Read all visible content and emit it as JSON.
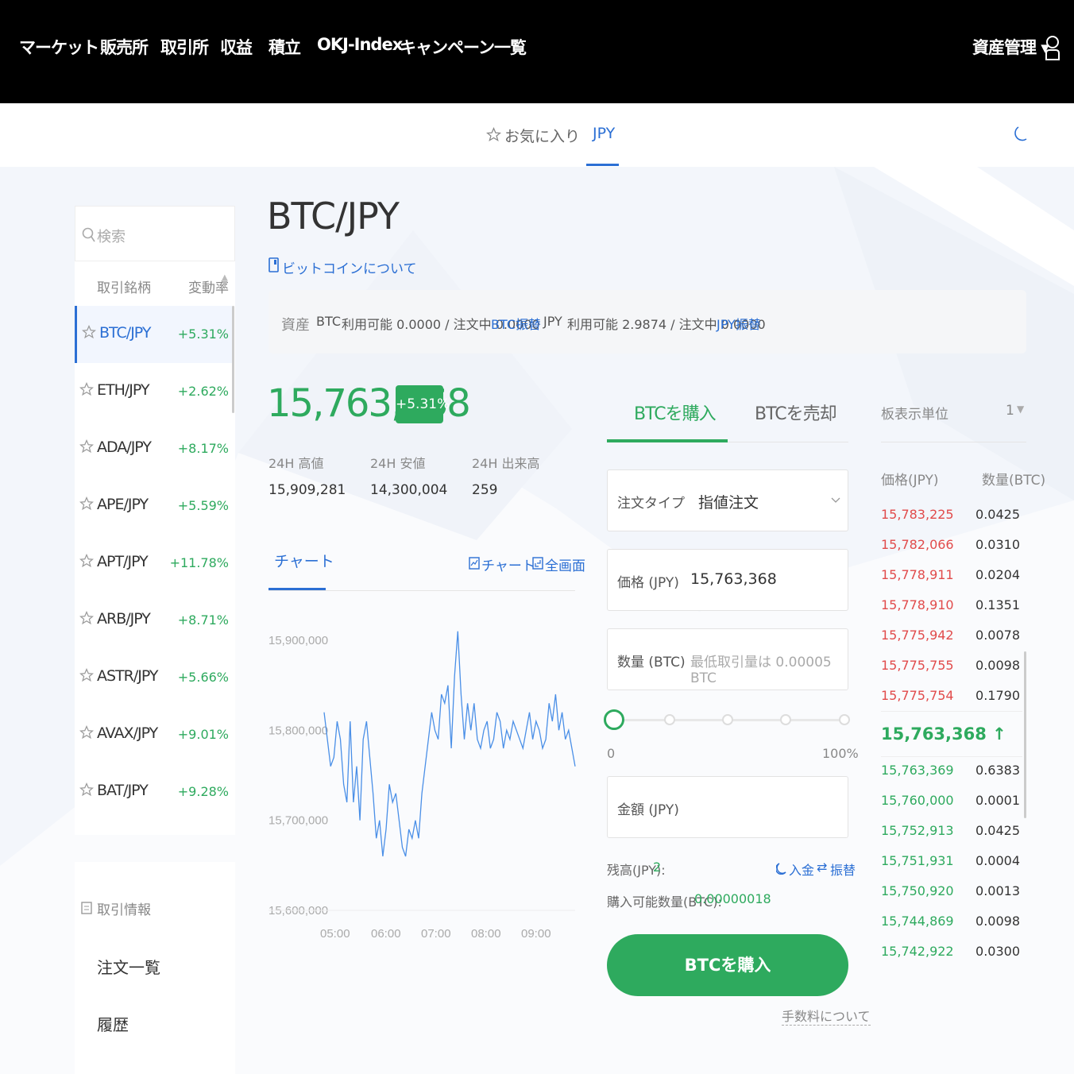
{
  "nav": {
    "items": [
      "マーケット",
      "販売所",
      "取引所",
      "収益",
      "積立",
      "OKJ-Index",
      "キャンペーン一覧"
    ],
    "asset_mgmt": "資産管理 ▾"
  },
  "subnav": {
    "favorites": "お気に入り",
    "jpy": "JPY"
  },
  "sidebar": {
    "search_placeholder": "検索",
    "col_pair": "取引銘柄",
    "col_change": "変動率",
    "pairs": [
      {
        "symbol": "BTC/JPY",
        "change": "+5.31%"
      },
      {
        "symbol": "ETH/JPY",
        "change": "+2.62%"
      },
      {
        "symbol": "ADA/JPY",
        "change": "+8.17%"
      },
      {
        "symbol": "APE/JPY",
        "change": "+5.59%"
      },
      {
        "symbol": "APT/JPY",
        "change": "+11.78%"
      },
      {
        "symbol": "ARB/JPY",
        "change": "+8.71%"
      },
      {
        "symbol": "ASTR/JPY",
        "change": "+5.66%"
      },
      {
        "symbol": "AVAX/JPY",
        "change": "+9.01%"
      },
      {
        "symbol": "BAT/JPY",
        "change": "+9.28%"
      }
    ],
    "trade_info": "取引情報",
    "order_list": "注文一覧",
    "history": "履歴"
  },
  "main": {
    "title": "BTC/JPY",
    "about": "ビットコインについて",
    "assets": {
      "label": "資産",
      "btc": "BTC",
      "btc_text": "利用可能 0.0000 / 注文中 0.0000",
      "btc_transfer": "BTC振替",
      "jpy": "JPY",
      "jpy_text": "利用可能 2.9874 / 注文中 0.0000",
      "jpy_transfer": "JPY振替"
    },
    "price": "15,763,368",
    "change_badge": "+5.31%",
    "stats": [
      {
        "label": "24H 高値",
        "value": "15,909,281"
      },
      {
        "label": "24H 安値",
        "value": "14,300,004"
      },
      {
        "label": "24H 出来高",
        "value": "259"
      }
    ],
    "chart_tab": "チャート",
    "chart_link": "チャート",
    "fullscreen": "全画面"
  },
  "chart_data": {
    "type": "line",
    "ylabels": [
      "15,900,000",
      "15,800,000",
      "15,700,000",
      "15,600,000"
    ],
    "ylim": [
      15600000,
      15900000
    ],
    "xlabels": [
      "05:00",
      "06:00",
      "07:00",
      "08:00",
      "09:00"
    ],
    "series_color": "#4a8fe7",
    "points": [
      15820000,
      15790000,
      15760000,
      15770000,
      15810000,
      15790000,
      15740000,
      15720000,
      15810000,
      15720000,
      15760000,
      15700000,
      15790000,
      15810000,
      15770000,
      15730000,
      15680000,
      15700000,
      15660000,
      15690000,
      15740000,
      15720000,
      15730000,
      15700000,
      15670000,
      15660000,
      15690000,
      15680000,
      15700000,
      15680000,
      15730000,
      15760000,
      15790000,
      15820000,
      15800000,
      15790000,
      15840000,
      15830000,
      15850000,
      15780000,
      15860000,
      15910000,
      15840000,
      15790000,
      15830000,
      15800000,
      15830000,
      15790000,
      15780000,
      15800000,
      15810000,
      15780000,
      15790000,
      15820000,
      15810000,
      15780000,
      15800000,
      15790000,
      15810000,
      15800000,
      15790000,
      15780000,
      15800000,
      15820000,
      15790000,
      15810000,
      15800000,
      15780000,
      15790000,
      15830000,
      15810000,
      15840000,
      15800000,
      15820000,
      15790000,
      15800000,
      15780000,
      15760000
    ]
  },
  "order_form": {
    "buy_tab": "BTCを購入",
    "sell_tab": "BTCを売却",
    "order_type_label": "注文タイプ",
    "order_type_value": "指値注文",
    "price_label": "価格 (JPY)",
    "price_value": "15,763,368",
    "qty_label": "数量 (BTC)",
    "qty_placeholder": "最低取引量は 0.00005 BTC",
    "slider_min": "0",
    "slider_max": "100%",
    "amount_label": "金額 (JPY)",
    "balance_label": "残高(JPY):",
    "balance_value": "2",
    "deposit": "入金",
    "transfer": "振替",
    "buyable_label": "購入可能数量(BTC):",
    "buyable_value": "0.00000018",
    "buy_button": "BTCを購入",
    "fee": "手数料について"
  },
  "orderbook": {
    "unit_label": "板表示単位",
    "unit_value": "1",
    "col_price": "価格(JPY)",
    "col_qty": "数量(BTC)",
    "asks": [
      {
        "price": "15,783,225",
        "qty": "0.0425"
      },
      {
        "price": "15,782,066",
        "qty": "0.0310"
      },
      {
        "price": "15,778,911",
        "qty": "0.0204"
      },
      {
        "price": "15,778,910",
        "qty": "0.1351"
      },
      {
        "price": "15,775,942",
        "qty": "0.0078"
      },
      {
        "price": "15,775,755",
        "qty": "0.0098"
      },
      {
        "price": "15,775,754",
        "qty": "0.1790"
      }
    ],
    "last_price": "15,763,368 ↑",
    "bids": [
      {
        "price": "15,763,369",
        "qty": "0.6383"
      },
      {
        "price": "15,760,000",
        "qty": "0.0001"
      },
      {
        "price": "15,752,913",
        "qty": "0.0425"
      },
      {
        "price": "15,751,931",
        "qty": "0.0004"
      },
      {
        "price": "15,750,920",
        "qty": "0.0013"
      },
      {
        "price": "15,744,869",
        "qty": "0.0098"
      },
      {
        "price": "15,742,922",
        "qty": "0.0300"
      }
    ],
    "ask_color": "#e14b4b",
    "bid_color": "#2eaa5e"
  }
}
